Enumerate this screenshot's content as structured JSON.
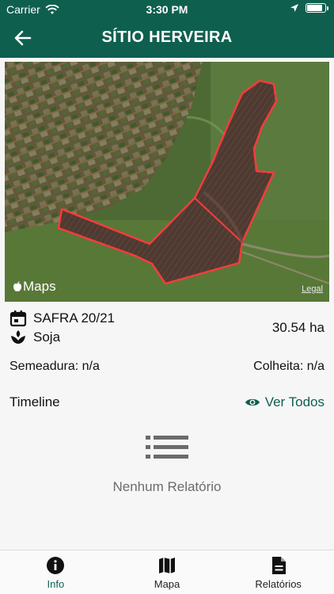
{
  "status": {
    "carrier": "Carrier",
    "time": "3:30 PM"
  },
  "header": {
    "title": "SÍTIO HERVEIRA"
  },
  "map": {
    "logo_text": "Maps",
    "legal_text": "Legal"
  },
  "crop": {
    "season": "SAFRA 20/21",
    "culture": "Soja",
    "area": "30.54 ha"
  },
  "dates": {
    "sowing": "Semeadura: n/a",
    "harvest": "Colheita: n/a"
  },
  "timeline": {
    "label": "Timeline",
    "see_all": "Ver Todos"
  },
  "reports": {
    "empty_message": "Nenhum Relatório"
  },
  "tabs": [
    {
      "label": "Info",
      "icon": "info-icon",
      "active": true
    },
    {
      "label": "Mapa",
      "icon": "map-icon",
      "active": false
    },
    {
      "label": "Relatórios",
      "icon": "document-icon",
      "active": false
    }
  ],
  "colors": {
    "primary": "#0f5f4f",
    "field_outline": "#ff3b3b"
  }
}
